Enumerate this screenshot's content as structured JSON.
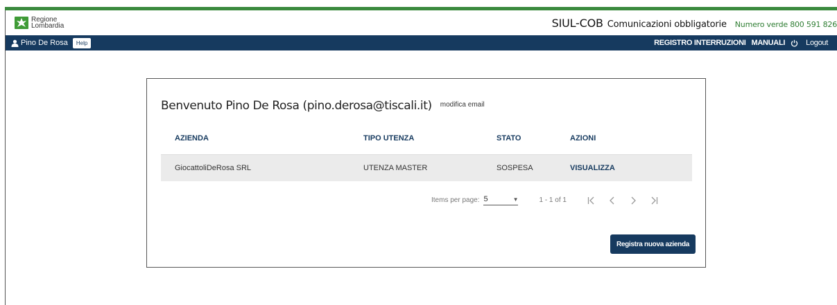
{
  "header": {
    "logo_line1": "Regione",
    "logo_line2": "Lombardia",
    "app_title": "SIUL-COB",
    "app_subtitle": "Comunicazioni obbligatorie",
    "phone": "Numero verde 800 591 826"
  },
  "navbar": {
    "user_name": "Pino De Rosa",
    "help_label": "Help",
    "registro_label": "REGISTRO INTERRUZIONI",
    "manuali_label": "MANUALI",
    "logout_label": "Logout"
  },
  "card": {
    "welcome": "Benvenuto Pino De Rosa (pino.derosa@tiscali.it)",
    "edit_email": "modifica email",
    "table": {
      "headers": [
        "AZIENDA",
        "TIPO UTENZA",
        "STATO",
        "AZIONI"
      ],
      "rows": [
        {
          "azienda": "GiocattoliDeRosa SRL",
          "tipo_utenza": "UTENZA MASTER",
          "stato": "SOSPESA",
          "azione": "VISUALIZZA"
        }
      ]
    },
    "pager": {
      "items_per_page_label": "Items per page:",
      "items_per_page_value": "5",
      "range": "1 - 1 of 1"
    },
    "register_button": "Registra nuova azienda"
  },
  "colors": {
    "nav_bg": "#163a5f",
    "brand_green": "#3b8a3e",
    "row_bg": "#ebebeb"
  },
  "icons": {
    "user": "user-icon",
    "logout": "power-icon",
    "first": "first-page-icon",
    "prev": "chevron-left-icon",
    "next": "chevron-right-icon",
    "last": "last-page-icon",
    "dropdown": "caret-down-icon"
  }
}
